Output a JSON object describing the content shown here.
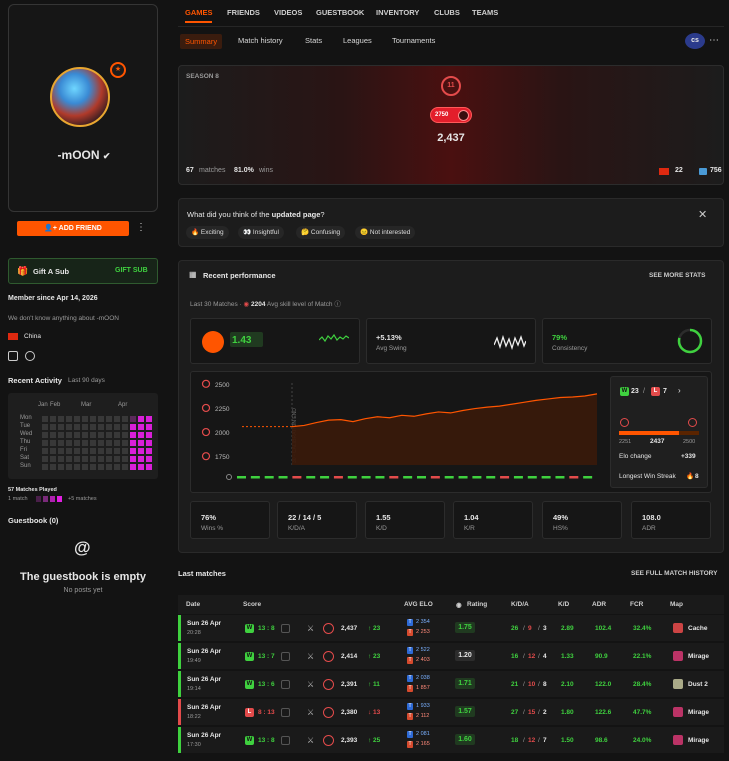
{
  "profile": {
    "nickname": "-mOON",
    "level": "8",
    "add_friend": "ADD FRIEND",
    "gift_label": "Gift A Sub",
    "gift_button": "GIFT SUB",
    "member_since": "Member since Apr 14, 2026",
    "about": "We don't know anything about -mOON",
    "country": "China"
  },
  "activity": {
    "title": "Recent Activity",
    "period": "Last 90 days",
    "months": [
      "Jan",
      "Feb",
      "Mar",
      "Apr"
    ],
    "days": [
      "Mon",
      "Tue",
      "Wed",
      "Thu",
      "Fri",
      "Sat",
      "Sun"
    ],
    "played": "57 Matches Played",
    "legend_min": "1 match",
    "legend_max": "+5 matches"
  },
  "guestbook": {
    "title": "Guestbook (0)",
    "empty_title": "The guestbook is empty",
    "empty_sub": "No posts yet"
  },
  "tabs": [
    "GAMES",
    "FRIENDS",
    "VIDEOS",
    "GUESTBOOK",
    "INVENTORY",
    "CLUBS",
    "TEAMS"
  ],
  "subtabs": [
    "Summary",
    "Match history",
    "Stats",
    "Leagues",
    "Tournaments"
  ],
  "game_badge": "cs",
  "season": {
    "label": "SEASON 8",
    "level": "11",
    "elo_badge": "2750",
    "elo": "2,437",
    "matches_value": "67",
    "matches_label": "matches",
    "wins_value": "81.0%",
    "wins_label": "wins",
    "country_rank": "22",
    "region_rank": "756"
  },
  "feedback": {
    "question_pre": "What did you think of the ",
    "question_bold": "updated page",
    "question_post": "?",
    "options": [
      "Exciting",
      "Insightful",
      "Confusing",
      "Not interested"
    ]
  },
  "performance": {
    "title": "Recent performance",
    "see_more": "SEE MORE STATS",
    "subtitle_pre": "Last 30 Matches",
    "skill_value": "2204",
    "subtitle_post": "Avg skill level of Match",
    "kd_value": "1.43",
    "swing_value": "+5.13%",
    "swing_label": "Avg Swing",
    "consistency_value": "79%",
    "consistency_label": "Consistency",
    "consistency_fraction": 0.79,
    "record_wins": "23",
    "record_losses": "7",
    "elo_min": "2251",
    "elo_current": "2437",
    "elo_max": "2500",
    "elo_change_label": "Elo change",
    "elo_change_value": "+339",
    "streak_label": "Longest Win Streak",
    "streak_value": "8",
    "calibration_label": "30 - CALIBRATION END",
    "stats": [
      {
        "value": "76%",
        "label": "Wins %"
      },
      {
        "value": "22 / 14 / 5",
        "label": "K/D/A"
      },
      {
        "value": "1.55",
        "label": "K/D"
      },
      {
        "value": "1.04",
        "label": "K/R"
      },
      {
        "value": "49%",
        "label": "HS%"
      },
      {
        "value": "108.0",
        "label": "ADR"
      }
    ]
  },
  "chart_data": {
    "type": "area",
    "yticks": [
      "2500",
      "2250",
      "2000",
      "1750"
    ],
    "ylim": [
      1700,
      2550
    ],
    "values": [
      2098,
      2110,
      2140,
      2165,
      2170,
      2150,
      2180,
      2200,
      2190,
      2215,
      2205,
      2230,
      2250,
      2240,
      2265,
      2285,
      2300,
      2310,
      2330,
      2350,
      2370,
      2385,
      2400,
      2405,
      2415,
      2437
    ],
    "results": [
      "W",
      "W",
      "W",
      "W",
      "L",
      "W",
      "W",
      "L",
      "W",
      "W",
      "W",
      "L",
      "W",
      "W",
      "L",
      "W",
      "W",
      "W",
      "W",
      "L",
      "W",
      "W",
      "W",
      "W",
      "L",
      "W"
    ]
  },
  "matches": {
    "title": "Last matches",
    "see_all": "SEE FULL MATCH HISTORY",
    "headers": [
      "Date",
      "Score",
      "AVG ELO",
      "Rating",
      "K/D/A",
      "K/D",
      "ADR",
      "FCR",
      "Map"
    ],
    "rows": [
      {
        "date": "Sun 26 Apr",
        "time": "20:28",
        "result": "W",
        "score": "13 : 8",
        "elo": "2,437",
        "delta": "↑ 23",
        "avg_a": "2 354",
        "avg_b": "2 253",
        "rating": "1.75",
        "k": "26",
        "d": "9",
        "a": "3",
        "kd": "2.89",
        "adr": "102.4",
        "fcr": "32.4%",
        "map": "Cache",
        "loss": false
      },
      {
        "date": "Sun 26 Apr",
        "time": "19:49",
        "result": "W",
        "score": "13 : 7",
        "elo": "2,414",
        "delta": "↑ 23",
        "avg_a": "2 522",
        "avg_b": "2 403",
        "rating": "1.20",
        "k": "16",
        "d": "12",
        "a": "4",
        "kd": "1.33",
        "adr": "90.9",
        "fcr": "22.1%",
        "map": "Mirage",
        "loss": false
      },
      {
        "date": "Sun 26 Apr",
        "time": "19:14",
        "result": "W",
        "score": "13 : 6",
        "elo": "2,391",
        "delta": "↑ 11",
        "avg_a": "2 038",
        "avg_b": "1 857",
        "rating": "1.71",
        "k": "21",
        "d": "10",
        "a": "8",
        "kd": "2.10",
        "adr": "122.0",
        "fcr": "28.4%",
        "map": "Dust 2",
        "loss": false
      },
      {
        "date": "Sun 26 Apr",
        "time": "18:22",
        "result": "L",
        "score": "8 : 13",
        "elo": "2,380",
        "delta": "↓ 13",
        "avg_a": "1 933",
        "avg_b": "2 112",
        "rating": "1.57",
        "k": "27",
        "d": "15",
        "a": "2",
        "kd": "1.80",
        "adr": "122.6",
        "fcr": "47.7%",
        "map": "Mirage",
        "loss": true
      },
      {
        "date": "Sun 26 Apr",
        "time": "17:30",
        "result": "W",
        "score": "13 : 8",
        "elo": "2,393",
        "delta": "↑ 25",
        "avg_a": "2 081",
        "avg_b": "2 165",
        "rating": "1.60",
        "k": "18",
        "d": "12",
        "a": "7",
        "kd": "1.50",
        "adr": "98.6",
        "fcr": "24.0%",
        "map": "Mirage",
        "loss": false
      }
    ]
  }
}
